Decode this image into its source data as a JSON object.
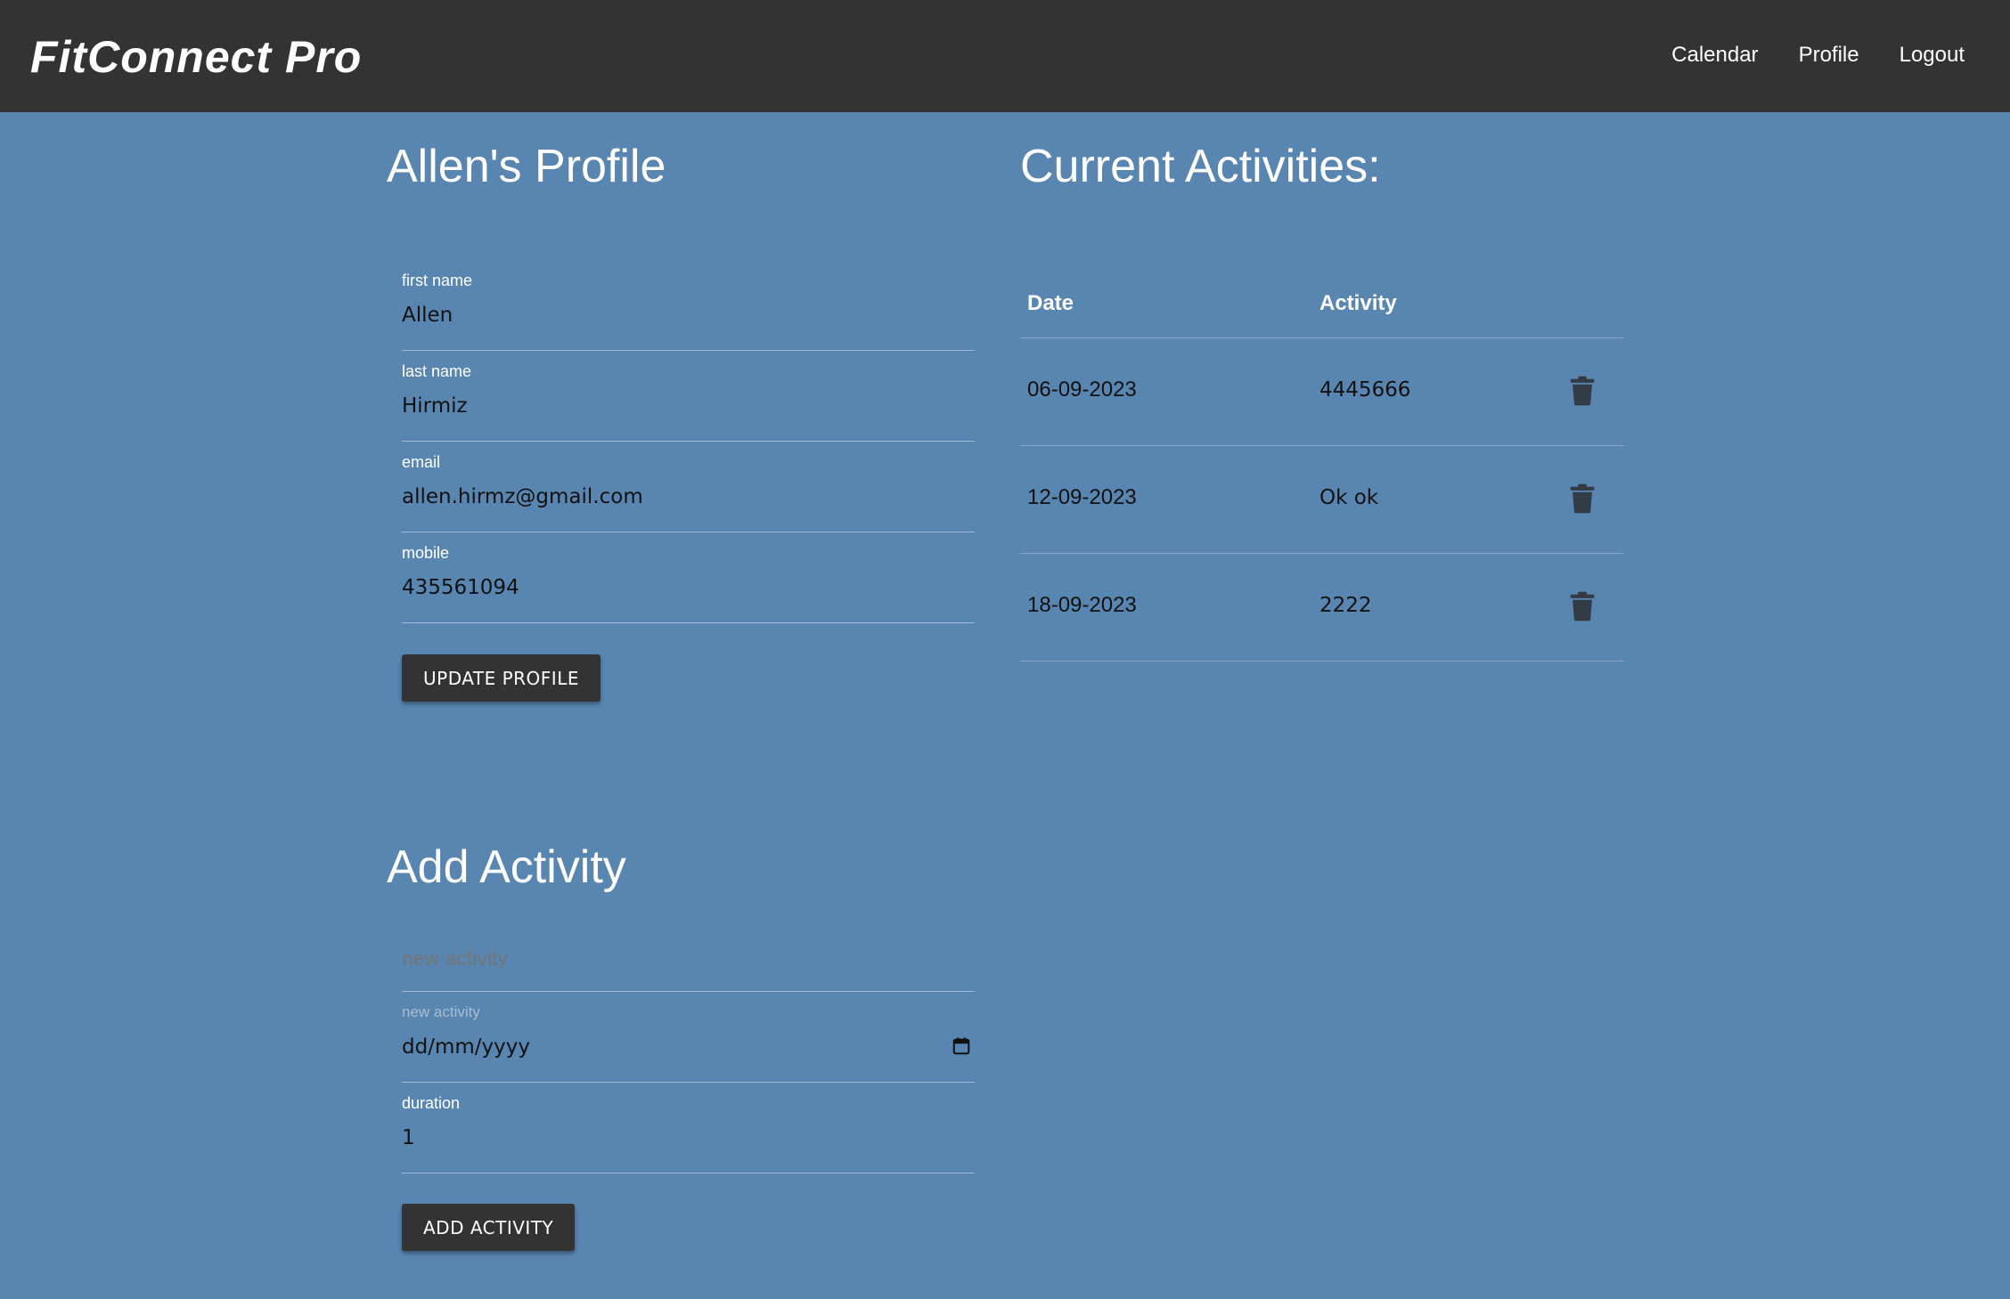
{
  "header": {
    "brand": "FitConnect Pro",
    "nav": [
      {
        "label": "Calendar"
      },
      {
        "label": "Profile"
      },
      {
        "label": "Logout"
      }
    ]
  },
  "profile": {
    "title": "Allen's Profile",
    "fields": {
      "first_name": {
        "label": "first name",
        "value": "Allen"
      },
      "last_name": {
        "label": "last name",
        "value": "Hirmiz"
      },
      "email": {
        "label": "email",
        "value": "allen.hirmz@gmail.com"
      },
      "mobile": {
        "label": "mobile",
        "value": "435561094"
      }
    },
    "update_button": "UPDATE PROFILE"
  },
  "add_activity": {
    "title": "Add Activity",
    "activity_input": {
      "placeholder": "new activity",
      "value": ""
    },
    "date_input": {
      "label": "new activity",
      "placeholder": "dd/mm/yyyy",
      "icon": "calendar-icon"
    },
    "duration_input": {
      "label": "duration",
      "value": "1"
    },
    "add_button": "ADD ACTIVITY"
  },
  "activities": {
    "title": "Current Activities:",
    "columns": [
      "Date",
      "Activity"
    ],
    "rows": [
      {
        "date": "06-09-2023",
        "activity": "4445666",
        "icon": "trash-icon"
      },
      {
        "date": "12-09-2023",
        "activity": "Ok ok",
        "icon": "trash-icon"
      },
      {
        "date": "18-09-2023",
        "activity": "2222",
        "icon": "trash-icon"
      }
    ]
  },
  "colors": {
    "page_background": "#5886b1",
    "header_background": "#333333",
    "button_background": "#333333",
    "icon_color": "#333b45"
  }
}
